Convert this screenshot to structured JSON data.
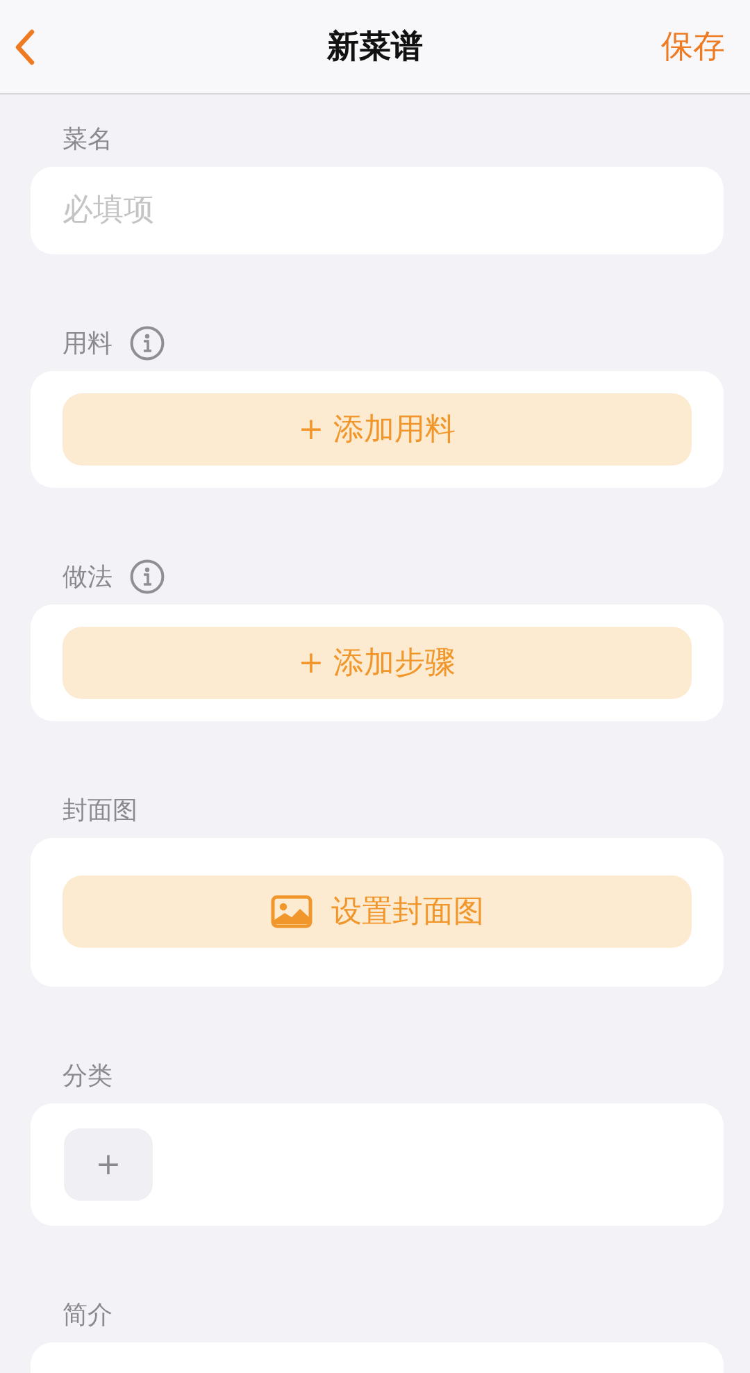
{
  "nav": {
    "title": "新菜谱",
    "action": "保存"
  },
  "sections": [
    {
      "label": "菜名",
      "info": false,
      "kind": "input",
      "placeholder": "必填项"
    },
    {
      "label": "用料",
      "info": true,
      "kind": "add",
      "button": "+ 添加用料"
    },
    {
      "label": "做法",
      "info": true,
      "kind": "add",
      "button": "+ 添加步骤"
    },
    {
      "label": "封面图",
      "info": false,
      "kind": "cover",
      "button": "设置封面图"
    },
    {
      "label": "分类",
      "info": false,
      "kind": "category",
      "button": "+"
    },
    {
      "label": "简介",
      "info": false,
      "kind": "text"
    }
  ]
}
